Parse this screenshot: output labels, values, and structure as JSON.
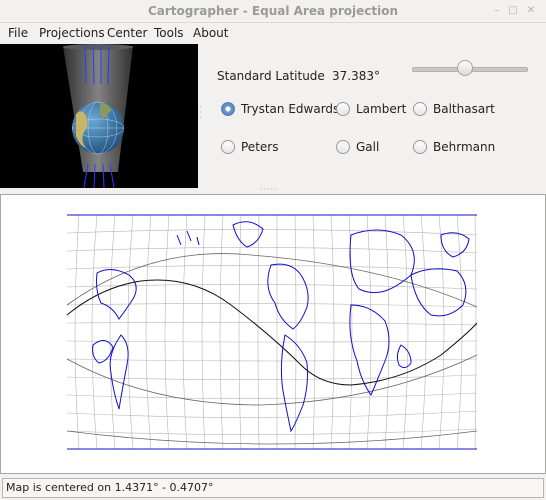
{
  "window": {
    "title": "Cartographer - Equal Area projection"
  },
  "menu": [
    "File",
    "Projections",
    "Center",
    "Tools",
    "About"
  ],
  "controls": {
    "standard_latitude_label": "Standard Latitude",
    "standard_latitude_value": "37.383°",
    "slider_fraction": 0.46,
    "options": [
      {
        "label": "Trystan Edwards",
        "selected": true
      },
      {
        "label": "Lambert",
        "selected": false
      },
      {
        "label": "Balthasart",
        "selected": false
      },
      {
        "label": "Peters",
        "selected": false
      },
      {
        "label": "Gall",
        "selected": false
      },
      {
        "label": "Behrmann",
        "selected": false
      }
    ]
  },
  "colors": {
    "coastline": "#0000cc",
    "graticule": "#aaaaaa",
    "path": "#000000",
    "preview_bg": "#000000"
  },
  "status": {
    "text": "Map is centered on 1.4371° - 0.4707°"
  }
}
